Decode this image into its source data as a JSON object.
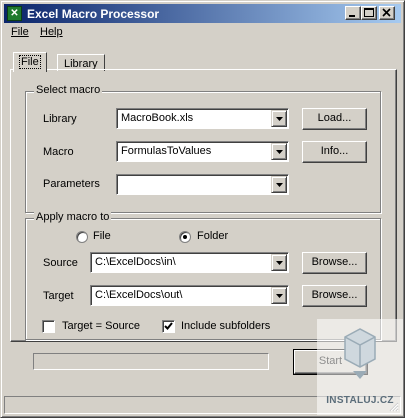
{
  "window": {
    "title": "Excel Macro Processor"
  },
  "menu": {
    "file": "File",
    "help": "Help"
  },
  "tabs": [
    {
      "label": "File"
    },
    {
      "label": "Library"
    }
  ],
  "select_macro": {
    "group_label": "Select macro",
    "library_label": "Library",
    "library_value": "MacroBook.xls",
    "load_button": "Load...",
    "macro_label": "Macro",
    "macro_value": "FormulasToValues",
    "info_button": "Info...",
    "parameters_label": "Parameters",
    "parameters_value": ""
  },
  "apply_macro": {
    "group_label": "Apply macro to",
    "radio_file": "File",
    "radio_folder": "Folder",
    "selected": "Folder",
    "source_label": "Source",
    "source_value": "C:\\ExcelDocs\\in\\",
    "target_label": "Target",
    "target_value": "C:\\ExcelDocs\\out\\",
    "browse_label": "Browse...",
    "target_equals_source_label": "Target = Source",
    "target_equals_source_checked": false,
    "include_subfolders_label": "Include subfolders",
    "include_subfolders_checked": true
  },
  "progress": {
    "fraction": 0
  },
  "start_button": "Start",
  "watermark": {
    "text": "INSTALUJ.CZ"
  },
  "colors": {
    "titlebar_start": "#0a246a",
    "titlebar_end": "#a6caf0",
    "face": "#d4d0c8"
  }
}
